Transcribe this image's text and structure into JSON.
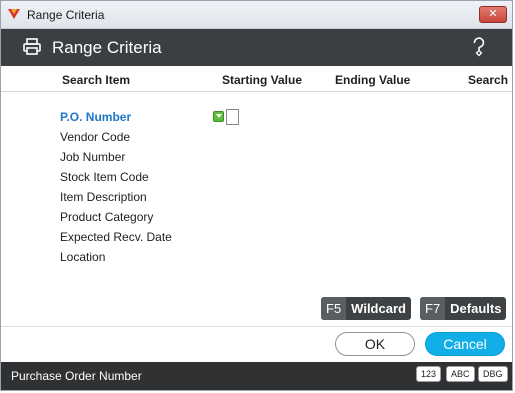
{
  "window": {
    "title": "Range Criteria",
    "close_label": "✕"
  },
  "header": {
    "title": "Range Criteria"
  },
  "columns": {
    "search_item": "Search Item",
    "starting_value": "Starting Value",
    "ending_value": "Ending Value",
    "search": "Search"
  },
  "fields": [
    {
      "label": "P.O. Number",
      "active": true
    },
    {
      "label": "Vendor Code"
    },
    {
      "label": "Job Number"
    },
    {
      "label": "Stock Item Code"
    },
    {
      "label": "Item Description"
    },
    {
      "label": "Product Category"
    },
    {
      "label": "Expected Recv. Date"
    },
    {
      "label": "Location"
    }
  ],
  "fkeys": {
    "wildcard": {
      "key": "F5",
      "label": "Wildcard"
    },
    "defaults": {
      "key": "F7",
      "label": "Defaults"
    }
  },
  "buttons": {
    "ok": "OK",
    "cancel": "Cancel"
  },
  "status": {
    "text": "Purchase Order Number",
    "indicators": [
      "123",
      "ABC",
      "DBG"
    ]
  },
  "colors": {
    "header_bg": "#3c3f41",
    "active_field": "#1f78c8",
    "cancel_bg": "#12aee8",
    "status_bg": "#2f3133"
  },
  "icons": [
    "app-logo-icon",
    "close-icon",
    "printer-icon",
    "help-icon",
    "expand-arrow-icon"
  ]
}
